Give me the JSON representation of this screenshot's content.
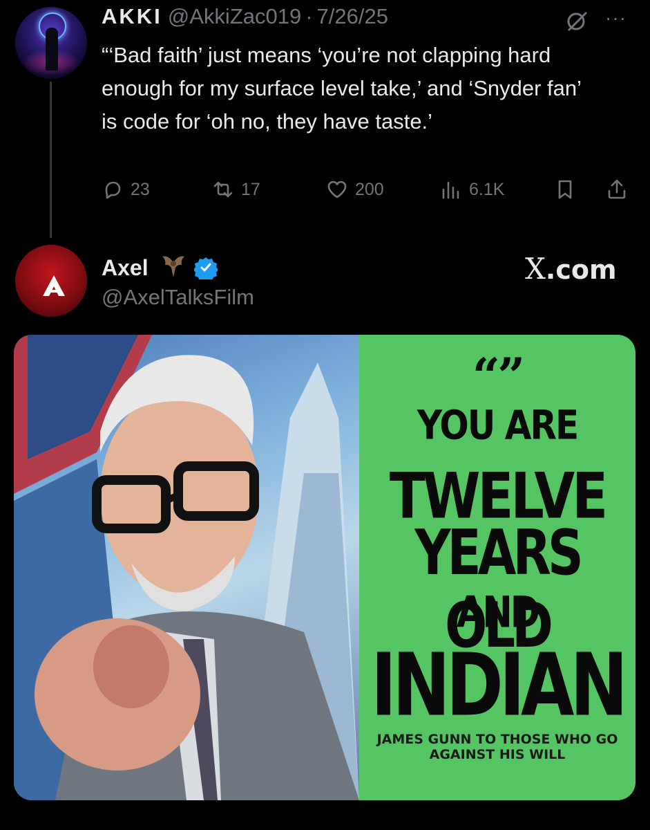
{
  "tweet1": {
    "display_name": "AKKI",
    "handle": "@AkkiZac019",
    "separator": "·",
    "date": "7/26/25",
    "text": "“‘Bad faith’ just means ‘you’re not clapping hard enough for my surface level take,’ and ‘Snyder fan’ is code for ‘oh no, they have taste.’",
    "more_label": "···",
    "metrics": {
      "replies": "23",
      "reposts": "17",
      "likes": "200",
      "views": "6.1K"
    },
    "icons": [
      "grok-icon",
      "more-icon",
      "reply-icon",
      "repost-icon",
      "like-icon",
      "views-icon",
      "bookmark-icon",
      "share-icon"
    ]
  },
  "tweet2": {
    "display_name": "Axel",
    "handle": "@AxelTalksFilm",
    "watermark_x": "X",
    "watermark_domain": ".com",
    "icons": [
      "bat-emoji-icon",
      "verified-badge-icon"
    ],
    "media": {
      "quote_marks": "“”",
      "line1": "YOU ARE",
      "line2": "TWELVE",
      "line3": "YEARS OLD",
      "line4": "AND",
      "line5": "INDIAN",
      "caption": "JAMES GUNN TO THOSE WHO GO AGAINST HIS WILL"
    }
  },
  "colors": {
    "background": "#000000",
    "text_primary": "#e7e9ea",
    "text_secondary": "#71767b",
    "verified_blue": "#1d9bf0",
    "meme_green": "#55c463",
    "avatar2_red": "#c0171d"
  }
}
